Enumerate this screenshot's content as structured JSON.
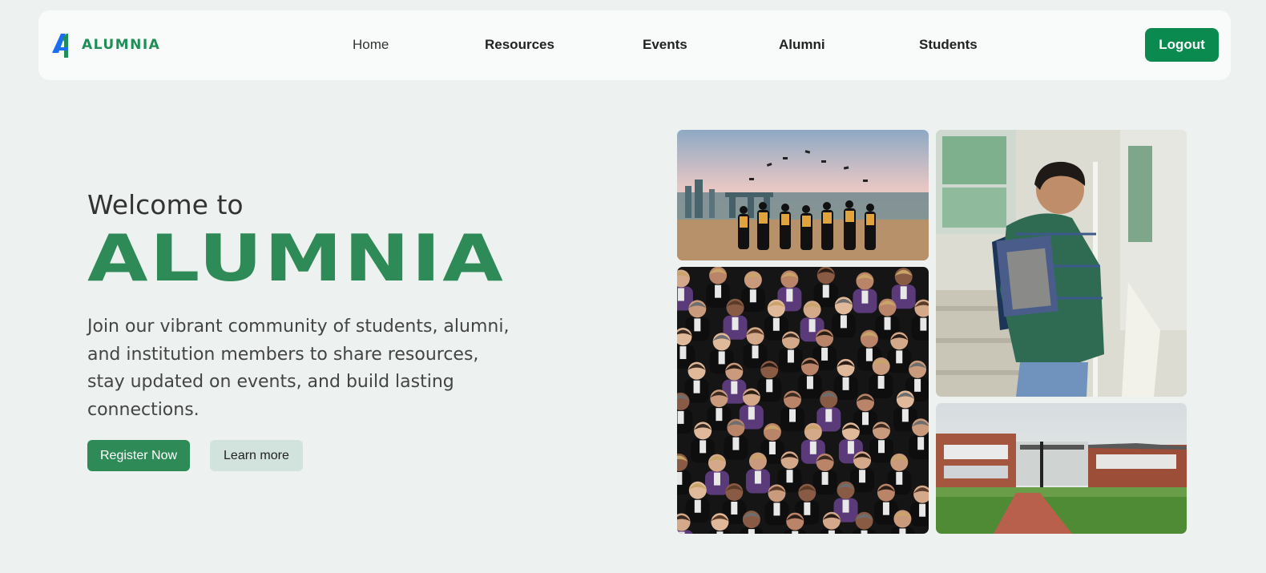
{
  "nav": {
    "brand": "ALUMNIA",
    "links": [
      "Home",
      "Resources",
      "Events",
      "Alumni",
      "Students"
    ],
    "logout_label": "Logout"
  },
  "hero": {
    "welcome": "Welcome to",
    "brand_name": "ALUMNIA",
    "description": "Join our vibrant community of students, alumni, and institution members to share resources, stay updated on events, and build lasting connections.",
    "register_label": "Register Now",
    "learn_label": "Learn more"
  },
  "colors": {
    "primary": "#2e8b57",
    "logout": "#0b8a4f",
    "page_bg": "#edf2f0",
    "nav_bg": "#f9fbfa",
    "secondary_button": "#d2e2dc",
    "logo_blue": "#1a6ff0"
  },
  "images": [
    {
      "name": "graduation-photo",
      "subject": "graduates throwing caps at sunset over city skyline"
    },
    {
      "name": "audience-photo",
      "subject": "formally dressed audience applauding in theater"
    },
    {
      "name": "student-photo",
      "subject": "smiling student carrying notebooks walking down stairs"
    },
    {
      "name": "campus-photo",
      "subject": "brick campus buildings with lawn and red path"
    }
  ]
}
